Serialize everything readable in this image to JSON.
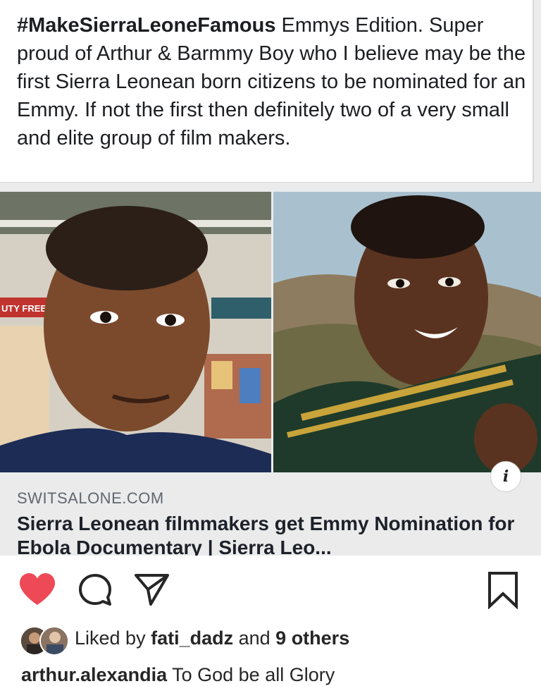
{
  "shared_post": {
    "hashtag": "#MakeSierraLeoneFamous",
    "caption": " Emmys Edition. Super proud of Arthur & Barmmy Boy who I believe may be the first Sierra Leonean born citizens to be nominated for an Emmy. If not the first then definitely two of a very small and elite group of film makers."
  },
  "link_preview": {
    "domain": "SWITSALONE.COM",
    "title": "Sierra Leonean filmmakers get Emmy Nomination for Ebola Documentary | Sierra Leo...",
    "info_glyph": "i",
    "left_photo_sign_text": "UTY FREE"
  },
  "actions": {
    "like_icon": "heart-filled-icon",
    "comment_icon": "comment-bubble-icon",
    "share_icon": "paper-plane-icon",
    "save_icon": "bookmark-icon",
    "like_color": "#ed4956"
  },
  "likes": {
    "prefix": "Liked by ",
    "user": "fati_dadz",
    "middle": " and ",
    "others": "9 others"
  },
  "comment": {
    "user": "arthur.alexandia",
    "text": " To God be all Glory"
  }
}
